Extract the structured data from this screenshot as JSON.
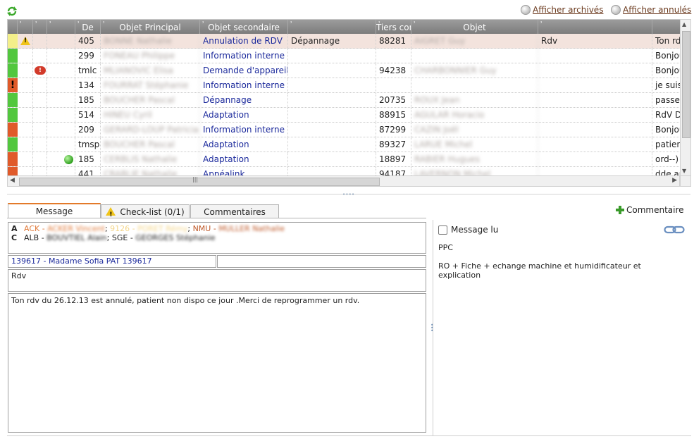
{
  "toolbar": {
    "refresh_icon": "refresh-icon",
    "show_archived": "Afficher archivés",
    "show_cancelled": "Afficher annulés"
  },
  "grid": {
    "columns": [
      "",
      "",
      "",
      "",
      "De",
      "Objet Principal",
      "Objet secondaire",
      "",
      "Tiers concerné",
      "Objet",
      ""
    ],
    "rows": [
      {
        "status": "yellow",
        "flag": "warning",
        "code": "405",
        "from": "BONNE Nathalie",
        "main": "Annulation de RDV",
        "secondary": "Dépannage",
        "num": "88281",
        "third": "AIGRET Guy",
        "objet": "Rdv",
        "text": "Ton rdv",
        "selected": true
      },
      {
        "status": "green",
        "flag": "",
        "code": "299",
        "from": "FONEAU Philippe",
        "main": "Information interne",
        "secondary": "",
        "num": "",
        "third": "",
        "objet": "",
        "text": "Bonjour"
      },
      {
        "status": "green",
        "flag": "bubble",
        "code": "tmlc",
        "from": "MLIANOVIC Elisa",
        "main": "Demande d'appareill",
        "secondary": "",
        "num": "94238",
        "third": "CHARBONNIER Guy",
        "objet": "",
        "text": "Bonjour"
      },
      {
        "status": "alert",
        "flag": "",
        "code": "134",
        "from": "FOURRAT Stéphanie",
        "main": "Information interne",
        "secondary": "",
        "num": "",
        "third": "",
        "objet": "",
        "text": "je suis"
      },
      {
        "status": "green",
        "flag": "",
        "code": "185",
        "from": "BOUCHER Pascal",
        "main": "Dépannage",
        "secondary": "",
        "num": "20735",
        "third": "ROUX Jean",
        "objet": "",
        "text": "passer"
      },
      {
        "status": "green",
        "flag": "",
        "code": "514",
        "from": "HINEU Cyril",
        "main": "Adaptation",
        "secondary": "",
        "num": "88915",
        "third": "AGULAR Horacio",
        "objet": "",
        "text": "RdV D"
      },
      {
        "status": "red",
        "flag": "",
        "code": "209",
        "from": "GERARD-LOUP Patricia",
        "main": "Information interne",
        "secondary": "",
        "num": "87299",
        "third": "CAZIN Joël",
        "objet": "",
        "text": "Bonjour"
      },
      {
        "status": "green",
        "flag": "",
        "code": "tmsp",
        "from": "BOUCHER Pascal",
        "main": "Adaptation",
        "secondary": "",
        "num": "89327",
        "third": "LARUE Michel",
        "objet": "",
        "text": "patien"
      },
      {
        "status": "red",
        "flag": "greendot",
        "code": "185",
        "from": "CERBLIS Nathalie",
        "main": "Adaptation",
        "secondary": "",
        "num": "18897",
        "third": "RABIER Hugues",
        "objet": "",
        "text": "ord--)"
      },
      {
        "status": "red",
        "flag": "",
        "code": "441",
        "from": "CRABLIE Nathalie",
        "main": "Appéalink",
        "secondary": "",
        "num": "94187",
        "third": "LAVERNON Michel",
        "objet": "",
        "text": "dde ar"
      }
    ]
  },
  "tabs": {
    "message": "Message",
    "checklist": "Check-list (0/1)",
    "comments": "Commentaires",
    "add_comment": "Commentaire"
  },
  "message": {
    "recipients_a_label": "A",
    "recipients_a": [
      {
        "code": "ACK",
        "name": "ACKER Vincent"
      },
      {
        "code": "9126",
        "name": "PORET Rémy"
      },
      {
        "code": "NMU",
        "name": "MULLER Nathalie"
      }
    ],
    "recipients_c_label": "C",
    "recipients_c": [
      {
        "code": "ALB",
        "name": "BOUVTIEL Alain"
      },
      {
        "code": "SGE",
        "name": "GEORGES Stéphanie"
      }
    ],
    "patient": "139617 - Madame Sofia PAT 139617",
    "subject": "Rdv",
    "body": "Ton rdv du 26.12.13 est annulé, patient non dispo ce jour .Merci de reprogrammer un rdv."
  },
  "right": {
    "read_label": "Message lu",
    "read_checked": false,
    "link_icon": "link-icon",
    "text": "PPC\n\nRO + Fiche + echange machine et humidificateur et explication"
  },
  "colors": {
    "header_bg": "#8a8a8a",
    "selected_row": "#f3e3dd",
    "status_green": "#52c73e",
    "status_red": "#e05a2a",
    "status_yellow": "#f3ef8a",
    "link_brown": "#6b3a1e",
    "object_blue": "#1c2a9c",
    "tab_accent": "#e37a2a"
  }
}
